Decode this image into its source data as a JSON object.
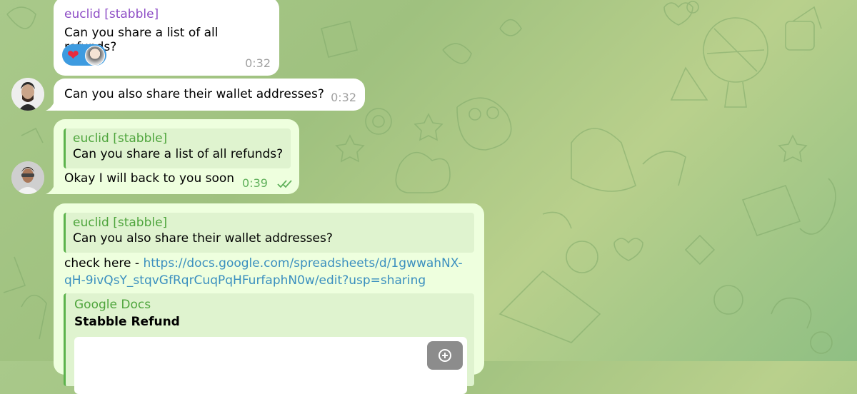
{
  "messages": [
    {
      "sender": "euclid [stabble]",
      "text": "Can you share a list of all refunds?",
      "time": "0:32"
    },
    {
      "text": "Can you also share their wallet addresses?",
      "time": "0:32"
    },
    {
      "reply_name": "euclid [stabble]",
      "reply_text": "Can you share a list of all refunds?",
      "text": "Okay I will back to you soon",
      "time": "0:39"
    },
    {
      "reply_name": "euclid [stabble]",
      "reply_text": "Can you also share their wallet addresses?",
      "text_prefix": "check here - ",
      "link_line1": "https://docs.google.com/spreadsheets/d/1gwwahNX-",
      "link_line2": "qH-9ivQsY_stqvGfRqrCuqPqHFurfaphN0w/edit?usp=sharing",
      "preview_site": "Google Docs",
      "preview_title": "Stabble Refund"
    }
  ],
  "colors": {
    "outgoing_bubble": "#eeffde",
    "incoming_bubble": "#ffffff",
    "sender_name": "#8e4ec6",
    "reply_accent": "#5cb34c",
    "link": "#3a8fbf"
  },
  "icons": [
    "heart-reaction-icon",
    "reactor-avatar",
    "double-check-icon",
    "zoom-icon"
  ]
}
